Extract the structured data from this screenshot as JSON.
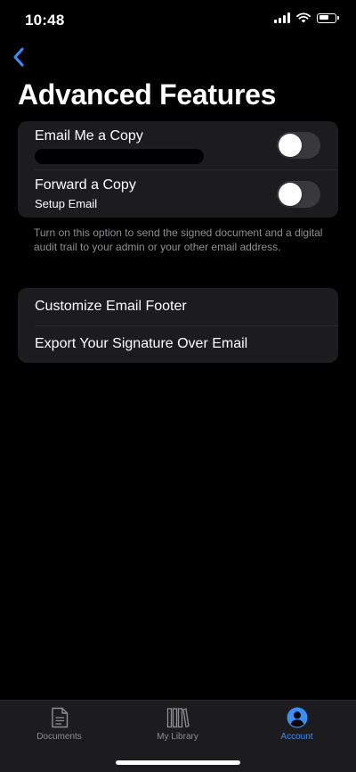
{
  "status_bar": {
    "time": "10:48"
  },
  "nav": {
    "back_icon": "chevron-left-icon",
    "title": "Advanced Features"
  },
  "email_group": {
    "email_me": {
      "label": "Email Me a Copy",
      "toggle_on": false
    },
    "forward": {
      "label": "Forward a Copy",
      "sublabel": "Setup Email",
      "toggle_on": false
    },
    "footnote": "Turn on this option to send the signed document and a digital audit trail to your admin or your other email address."
  },
  "actions_group": {
    "items": [
      {
        "label": "Customize Email Footer"
      },
      {
        "label": "Export Your Signature Over Email"
      }
    ]
  },
  "tab_bar": {
    "tabs": [
      {
        "label": "Documents",
        "icon": "document-icon",
        "active": false
      },
      {
        "label": "My Library",
        "icon": "library-icon",
        "active": false
      },
      {
        "label": "Account",
        "icon": "account-icon",
        "active": true
      }
    ]
  },
  "colors": {
    "accent": "#3a8ef6",
    "background": "#000000",
    "group_background": "#1c1c1e",
    "secondary_text": "#8e8e93",
    "toggle_off": "#39393d"
  }
}
